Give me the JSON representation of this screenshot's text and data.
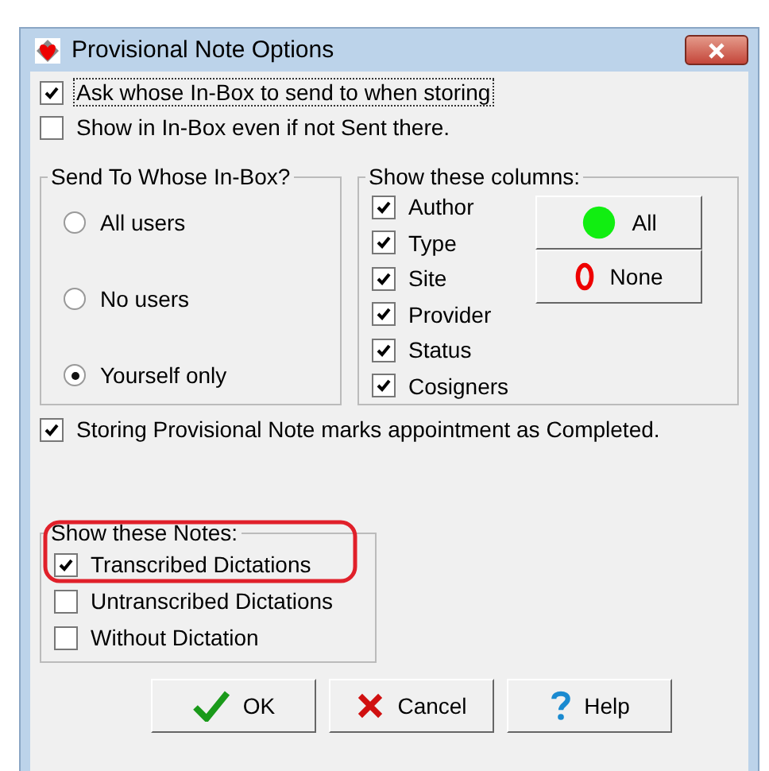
{
  "window": {
    "title": "Provisional Note Options"
  },
  "options": [
    {
      "label": "Ask whose In-Box to send to when storing",
      "checked": true,
      "focused": true
    },
    {
      "label": "Show in In-Box even if not Sent there.",
      "checked": false,
      "focused": false
    }
  ],
  "send_to": {
    "title": "Send To Whose In-Box?",
    "options": [
      {
        "label": "All users",
        "selected": false
      },
      {
        "label": "No users",
        "selected": false
      },
      {
        "label": "Yourself only",
        "selected": true
      }
    ]
  },
  "columns": {
    "title": "Show these columns:",
    "items": [
      {
        "label": "Author",
        "checked": true
      },
      {
        "label": "Type",
        "checked": true
      },
      {
        "label": "Site",
        "checked": true
      },
      {
        "label": "Provider",
        "checked": true
      },
      {
        "label": "Status",
        "checked": true
      },
      {
        "label": "Cosigners",
        "checked": true
      }
    ],
    "buttons": [
      {
        "label": "All",
        "kind": "all"
      },
      {
        "label": "None",
        "kind": "none"
      }
    ]
  },
  "completed_option": {
    "label": "Storing Provisional Note marks appointment as Completed.",
    "checked": true
  },
  "notes": {
    "title": "Show these Notes:",
    "items": [
      {
        "label": "Transcribed Dictations",
        "checked": true
      },
      {
        "label": "Untranscribed Dictations",
        "checked": false
      },
      {
        "label": "Without Dictation",
        "checked": false
      }
    ]
  },
  "buttons": [
    {
      "label": "OK",
      "kind": "ok"
    },
    {
      "label": "Cancel",
      "kind": "cancel"
    },
    {
      "label": "Help",
      "kind": "help"
    }
  ]
}
